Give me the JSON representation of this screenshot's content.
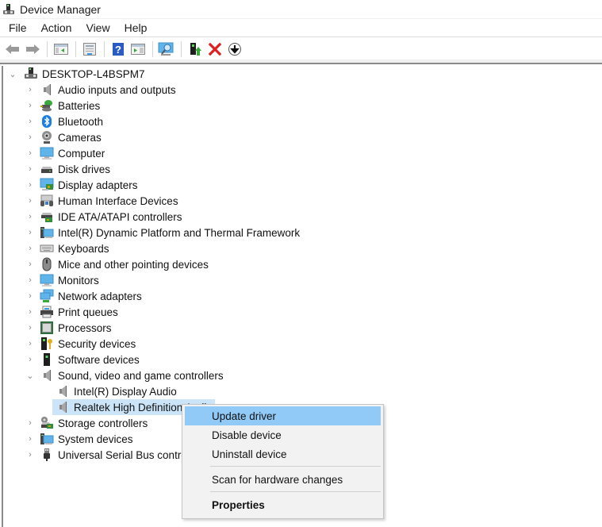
{
  "window": {
    "title": "Device Manager",
    "icon": "device-manager-icon"
  },
  "menubar": {
    "items": [
      "File",
      "Action",
      "View",
      "Help"
    ]
  },
  "toolbar": {
    "buttons": [
      {
        "name": "back-button",
        "icon": "arrow-left-icon"
      },
      {
        "name": "forward-button",
        "icon": "arrow-right-icon"
      },
      {
        "name": "show-hide-console-tree-button",
        "icon": "console-tree-icon"
      },
      {
        "name": "properties-button",
        "icon": "properties-sheet-icon"
      },
      {
        "name": "help-button",
        "icon": "help-icon"
      },
      {
        "name": "show-action-pane-button",
        "icon": "action-pane-icon"
      },
      {
        "name": "scan-hardware-button",
        "icon": "scan-monitor-icon"
      },
      {
        "name": "update-driver-button",
        "icon": "update-driver-icon"
      },
      {
        "name": "uninstall-device-button",
        "icon": "red-x-icon"
      },
      {
        "name": "disable-device-button",
        "icon": "down-arrow-circle-icon"
      }
    ]
  },
  "tree": {
    "root": {
      "label": "DESKTOP-L4BSPM7",
      "expanded": true,
      "icon": "computer-tower-icon"
    },
    "categories": [
      {
        "label": "Audio inputs and outputs",
        "icon": "speaker-icon",
        "expanded": false
      },
      {
        "label": "Batteries",
        "icon": "battery-icon",
        "expanded": false
      },
      {
        "label": "Bluetooth",
        "icon": "bluetooth-icon",
        "expanded": false
      },
      {
        "label": "Cameras",
        "icon": "webcam-icon",
        "expanded": false
      },
      {
        "label": "Computer",
        "icon": "monitor-icon",
        "expanded": false
      },
      {
        "label": "Disk drives",
        "icon": "disk-drive-icon",
        "expanded": false
      },
      {
        "label": "Display adapters",
        "icon": "display-adapter-icon",
        "expanded": false
      },
      {
        "label": "Human Interface Devices",
        "icon": "hid-icon",
        "expanded": false
      },
      {
        "label": "IDE ATA/ATAPI controllers",
        "icon": "ide-controller-icon",
        "expanded": false
      },
      {
        "label": "Intel(R) Dynamic Platform and Thermal Framework",
        "icon": "system-device-icon",
        "expanded": false
      },
      {
        "label": "Keyboards",
        "icon": "keyboard-icon",
        "expanded": false
      },
      {
        "label": "Mice and other pointing devices",
        "icon": "mouse-icon",
        "expanded": false
      },
      {
        "label": "Monitors",
        "icon": "monitor-icon",
        "expanded": false
      },
      {
        "label": "Network adapters",
        "icon": "network-icon",
        "expanded": false
      },
      {
        "label": "Print queues",
        "icon": "printer-icon",
        "expanded": false
      },
      {
        "label": "Processors",
        "icon": "processor-icon",
        "expanded": false
      },
      {
        "label": "Security devices",
        "icon": "security-device-icon",
        "expanded": false
      },
      {
        "label": "Software devices",
        "icon": "software-device-icon",
        "expanded": false
      },
      {
        "label": "Sound, video and game controllers",
        "icon": "speaker-icon",
        "expanded": true,
        "children": [
          {
            "label": "Intel(R) Display Audio",
            "icon": "speaker-icon",
            "selected": false
          },
          {
            "label": "Realtek High Definition Audio",
            "icon": "speaker-icon",
            "selected": true
          }
        ]
      },
      {
        "label": "Storage controllers",
        "icon": "storage-controller-icon",
        "expanded": false
      },
      {
        "label": "System devices",
        "icon": "system-device-icon",
        "expanded": false
      },
      {
        "label": "Universal Serial Bus controllers",
        "icon": "usb-icon",
        "expanded": false
      }
    ]
  },
  "context_menu": {
    "items": [
      {
        "label": "Update driver",
        "highlighted": true,
        "bold": false
      },
      {
        "label": "Disable device",
        "highlighted": false,
        "bold": false
      },
      {
        "label": "Uninstall device",
        "highlighted": false,
        "bold": false
      },
      {
        "separator": true
      },
      {
        "label": "Scan for hardware changes",
        "highlighted": false,
        "bold": false
      },
      {
        "separator": true
      },
      {
        "label": "Properties",
        "highlighted": false,
        "bold": true
      }
    ]
  },
  "colors": {
    "selection": "#cce4f7",
    "menu_highlight": "#91c9f7",
    "menu_background": "#f2f2f2"
  }
}
